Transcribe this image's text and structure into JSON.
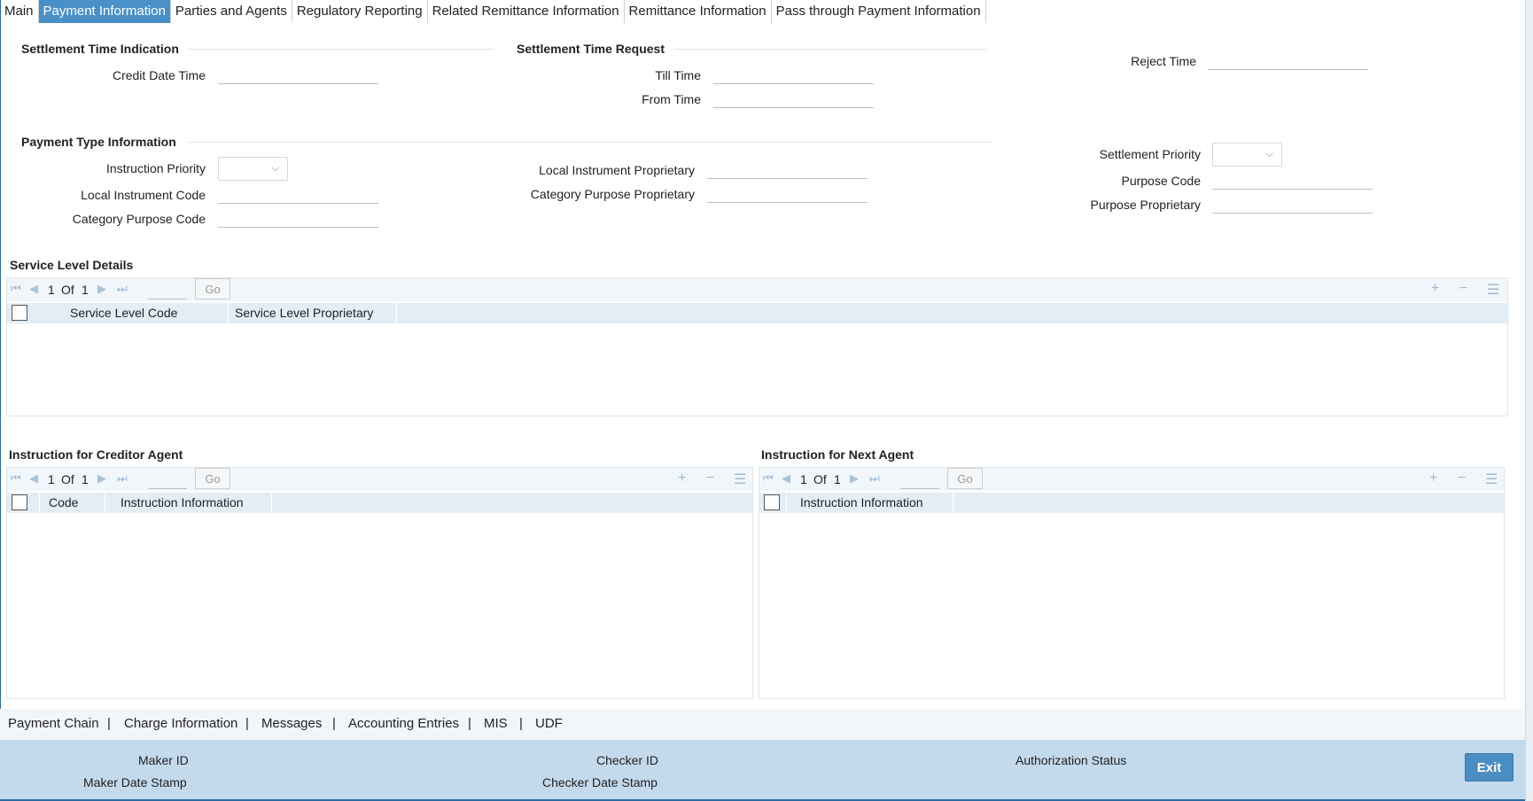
{
  "tabs": [
    "Main",
    "Payment Information",
    "Parties and Agents",
    "Regulatory Reporting",
    "Related Remittance Information",
    "Remittance Information",
    "Pass through Payment Information"
  ],
  "settlement_time_indication": {
    "title": "Settlement Time Indication",
    "credit_date_time_label": "Credit Date Time",
    "credit_date_time_value": ""
  },
  "settlement_time_request": {
    "title": "Settlement Time Request",
    "till_time_label": "Till Time",
    "till_time_value": "",
    "from_time_label": "From Time",
    "from_time_value": ""
  },
  "reject_time": {
    "label": "Reject Time",
    "value": ""
  },
  "payment_type_information": {
    "title": "Payment Type Information",
    "instruction_priority_label": "Instruction Priority",
    "instruction_priority_value": "",
    "local_instrument_code_label": "Local Instrument Code",
    "local_instrument_code_value": "",
    "category_purpose_code_label": "Category Purpose Code",
    "category_purpose_code_value": "",
    "local_instrument_proprietary_label": "Local Instrument Proprietary",
    "local_instrument_proprietary_value": "",
    "category_purpose_proprietary_label": "Category Purpose Proprietary",
    "category_purpose_proprietary_value": "",
    "settlement_priority_label": "Settlement Priority",
    "settlement_priority_value": "",
    "purpose_code_label": "Purpose Code",
    "purpose_code_value": "",
    "purpose_proprietary_label": "Purpose Proprietary",
    "purpose_proprietary_value": ""
  },
  "service_level": {
    "title": "Service Level Details",
    "page_current": "1",
    "page_of": "Of",
    "page_total": "1",
    "go_label": "Go",
    "columns": [
      "Service Level Code",
      "Service Level Proprietary"
    ]
  },
  "creditor_agent": {
    "title": "Instruction for Creditor Agent",
    "page_current": "1",
    "page_of": "Of",
    "page_total": "1",
    "go_label": "Go",
    "columns": [
      "Code",
      "Instruction Information"
    ]
  },
  "next_agent": {
    "title": "Instruction for Next Agent",
    "page_current": "1",
    "page_of": "Of",
    "page_total": "1",
    "go_label": "Go",
    "columns": [
      "Instruction Information"
    ]
  },
  "bottom_links": [
    "Payment Chain",
    "Charge Information",
    "Messages",
    "Accounting Entries",
    "MIS",
    "UDF"
  ],
  "link_separator": "|",
  "footer": {
    "maker_id": "Maker ID",
    "maker_date_stamp": "Maker Date Stamp",
    "checker_id": "Checker ID",
    "checker_date_stamp": "Checker Date Stamp",
    "authorization_status": "Authorization Status",
    "exit_label": "Exit"
  },
  "icons": {
    "first": "⏮",
    "prev": "◀",
    "next": "▶",
    "last": "⏭",
    "add": "+",
    "remove": "−",
    "list": "☰",
    "chevron": "⌵"
  },
  "colors": {
    "active_tab": "#4a90c8",
    "footer": "#c3daed",
    "grid_header": "#e3edf6",
    "exit_button": "#4a8dc3"
  }
}
